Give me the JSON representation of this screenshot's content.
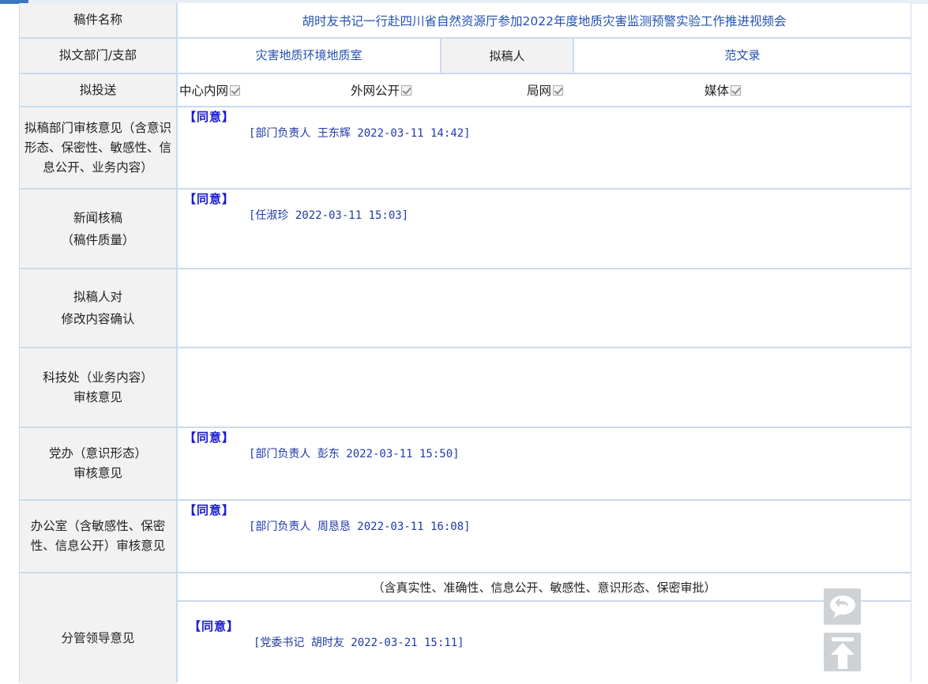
{
  "colors": {
    "accent_blue": "#2350b0",
    "agree_blue": "#1a1ad6",
    "label_bg": "#f2f2f2",
    "grid": "#c9dbee"
  },
  "manuscript_name": {
    "label": "稿件名称",
    "value": "胡时友书记一行赴四川省自然资源厅参加2022年度地质灾害监测预警实验工作推进视频会"
  },
  "draft_dept": {
    "label": "拟文部门/支部",
    "value": "灾害地质环境地质室",
    "drafter_label": "拟稿人",
    "drafter_value": "范文录"
  },
  "send_to": {
    "label": "拟投送",
    "options": [
      {
        "label": "中心内网",
        "checked": true
      },
      {
        "label": "外网公开",
        "checked": true
      },
      {
        "label": "局网",
        "checked": true
      },
      {
        "label": "媒体",
        "checked": true
      }
    ]
  },
  "reviews": [
    {
      "label": "拟稿部门审核意见（含意识形态、保密性、敏感性、信息公开、业务内容）",
      "opinion": "【同意】",
      "signature": "[部门负责人 王东辉 2022-03-11 14:42]"
    },
    {
      "label_line1": "新闻核稿",
      "label_line2": "（稿件质量）",
      "opinion": "【同意】",
      "signature": "[任淑珍 2022-03-11 15:03]"
    },
    {
      "label_line1": "拟稿人对",
      "label_line2": "修改内容确认",
      "opinion": "",
      "signature": ""
    },
    {
      "label_line1": "科技处（业务内容）",
      "label_line2": "审核意见",
      "opinion": "",
      "signature": ""
    },
    {
      "label_line1": "党办（意识形态）",
      "label_line2": "审核意见",
      "opinion": "【同意】",
      "signature": "[部门负责人 彭东 2022-03-11 15:50]"
    },
    {
      "label": "办公室（含敏感性、保密性、信息公开）审核意见",
      "opinion": "【同意】",
      "signature": "[部门负责人 周恳恳 2022-03-11 16:08]"
    }
  ],
  "leader": {
    "label": "分管领导意见",
    "note": "（含真实性、准确性、信息公开、敏感性、意识形态、保密审批）",
    "opinion": "【同意】",
    "signature": "[党委书记 胡时友 2022-03-21 15:11]"
  },
  "float_buttons": {
    "reply_icon": "comment-reply-icon",
    "top_icon": "back-to-top-icon"
  }
}
